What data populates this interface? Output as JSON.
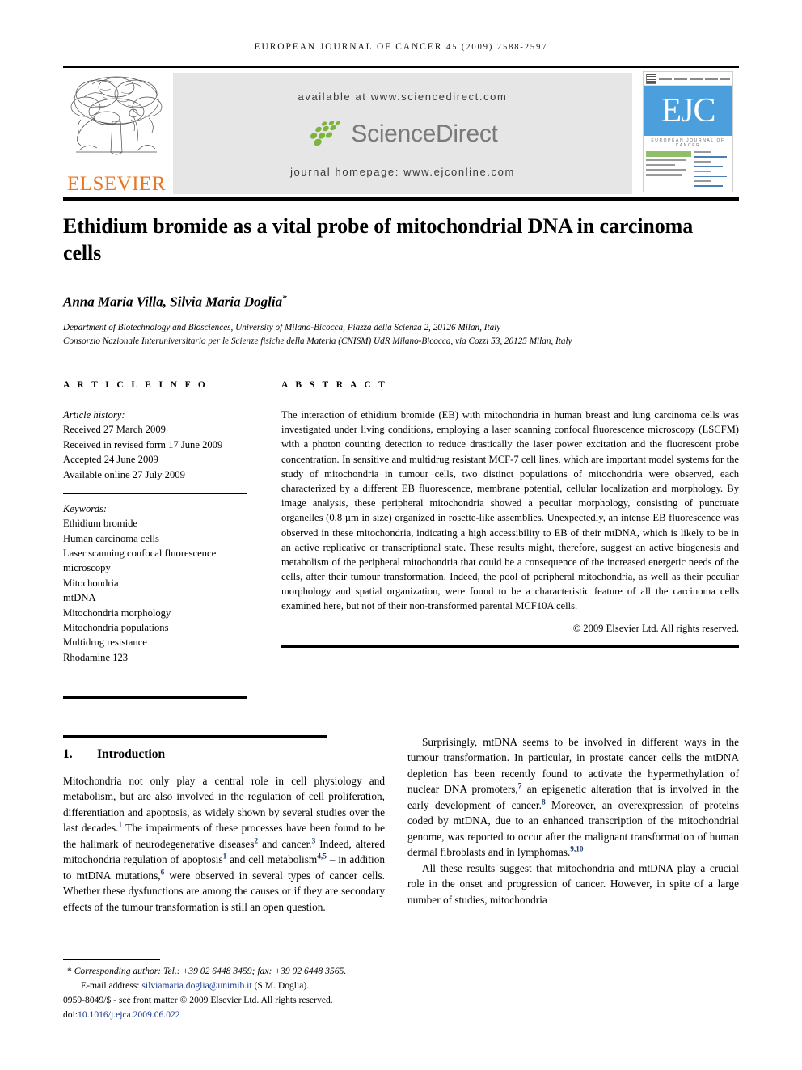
{
  "running_head": {
    "journal": "EUROPEAN JOURNAL OF CANCER",
    "volume_year_pages": "45 (2009) 2588-2597"
  },
  "masthead": {
    "publisher": "ELSEVIER",
    "available_at": "available at www.sciencedirect.com",
    "sciencedirect_wordmark": "ScienceDirect",
    "journal_homepage": "journal homepage: www.ejconline.com",
    "cover": {
      "acronym": "EJC",
      "subtitle": "EUROPEAN JOURNAL OF CANCER"
    },
    "colors": {
      "elsevier_orange": "#E87722",
      "banner_gray": "#E6E6E6",
      "sciencedirect_green": "#7DB33E",
      "sciencedirect_gray": "#7A7A7A",
      "cover_blue": "#4A9FDC"
    }
  },
  "article": {
    "title": "Ethidium bromide as a vital probe of mitochondrial DNA in carcinoma cells",
    "authors": "Anna Maria Villa, Silvia Maria Doglia",
    "author_corresponding_mark": "*",
    "affiliations": [
      "Department of Biotechnology and Biosciences, University of Milano-Bicocca, Piazza della Scienza 2, 20126 Milan, Italy",
      "Consorzio Nazionale Interuniversitario per le Scienze fisiche della Materia (CNISM) UdR Milano-Bicocca, via Cozzi 53, 20125 Milan, Italy"
    ]
  },
  "article_info": {
    "heading": "A R T I C L E   I N F O",
    "history_label": "Article history:",
    "history": [
      "Received 27 March 2009",
      "Received in revised form 17 June 2009",
      "Accepted 24 June 2009",
      "Available online 27 July 2009"
    ],
    "keywords_label": "Keywords:",
    "keywords": [
      "Ethidium bromide",
      "Human carcinoma cells",
      "Laser scanning confocal fluorescence microscopy",
      "Mitochondria",
      "mtDNA",
      "Mitochondria morphology",
      "Mitochondria populations",
      "Multidrug resistance",
      "Rhodamine 123"
    ]
  },
  "abstract": {
    "heading": "A B S T R A C T",
    "text": "The interaction of ethidium bromide (EB) with mitochondria in human breast and lung carcinoma cells was investigated under living conditions, employing a laser scanning confocal fluorescence microscopy (LSCFM) with a photon counting detection to reduce drastically the laser power excitation and the fluorescent probe concentration. In sensitive and multidrug resistant MCF-7 cell lines, which are important model systems for the study of mitochondria in tumour cells, two distinct populations of mitochondria were observed, each characterized by a different EB fluorescence, membrane potential, cellular localization and morphology. By image analysis, these peripheral mitochondria showed a peculiar morphology, consisting of punctuate organelles (0.8 µm in size) organized in rosette-like assemblies. Unexpectedly, an intense EB fluorescence was observed in these mitochondria, indicating a high accessibility to EB of their mtDNA, which is likely to be in an active replicative or transcriptional state. These results might, therefore, suggest an active biogenesis and metabolism of the peripheral mitochondria that could be a consequence of the increased energetic needs of the cells, after their tumour transformation. Indeed, the pool of peripheral mitochondria, as well as their peculiar morphology and spatial organization, were found to be a characteristic feature of all the carcinoma cells examined here, but not of their non-transformed parental MCF10A cells.",
    "copyright": "© 2009 Elsevier Ltd. All rights reserved."
  },
  "body": {
    "section_number": "1.",
    "section_title": "Introduction",
    "left_paragraph_1_a": "Mitochondria not only play a central role in cell physiology and metabolism, but are also involved in the regulation of cell proliferation, differentiation and apoptosis, as widely shown by several studies over the last decades.",
    "left_ref_1": "1",
    "left_paragraph_1_b": " The impairments of these processes have been found to be the hallmark of neurodegenerative diseases",
    "left_ref_2": "2",
    "left_paragraph_1_c": " and cancer.",
    "left_ref_3": "3",
    "left_paragraph_1_d": " Indeed, altered mitochondria regulation of apoptosis",
    "left_ref_4": "1",
    "left_paragraph_1_e": " and cell metabolism",
    "left_ref_5": "4,5",
    "left_paragraph_1_f": " – in addition to mtDNA mutations,",
    "left_ref_6": "6",
    "left_paragraph_1_g": " were observed in several types of cancer cells. Whether these dysfunctions are among the causes or if they are secondary effects of the tumour transformation is still an open question.",
    "right_paragraph_1_a": "Surprisingly, mtDNA seems to be involved in different ways in the tumour transformation. In particular, in prostate cancer cells the mtDNA depletion has been recently found to activate the hypermethylation of nuclear DNA promoters,",
    "right_ref_7": "7",
    "right_paragraph_1_b": " an epigenetic alteration that is involved in the early development of cancer.",
    "right_ref_8": "8",
    "right_paragraph_1_c": " Moreover, an overexpression of proteins coded by mtDNA, due to an enhanced transcription of the mitochondrial genome, was reported to occur after the malignant transformation of human dermal fibroblasts and in lymphomas.",
    "right_ref_9": "9,10",
    "right_paragraph_2": "All these results suggest that mitochondria and mtDNA play a crucial role in the onset and progression of cancer. However, in spite of a large number of studies, mitochondria"
  },
  "footnotes": {
    "corresponding_mark": "*",
    "corresponding": "Corresponding author: Tel.: +39 02 6448 3459; fax: +39 02 6448 3565.",
    "email_label": "E-mail address:",
    "email": "silviamaria.doglia@unimib.it",
    "email_suffix": "(S.M. Doglia).",
    "issn_line": "0959-8049/$ - see front matter © 2009 Elsevier Ltd. All rights reserved.",
    "doi_label": "doi:",
    "doi": "10.1016/j.ejca.2009.06.022"
  }
}
